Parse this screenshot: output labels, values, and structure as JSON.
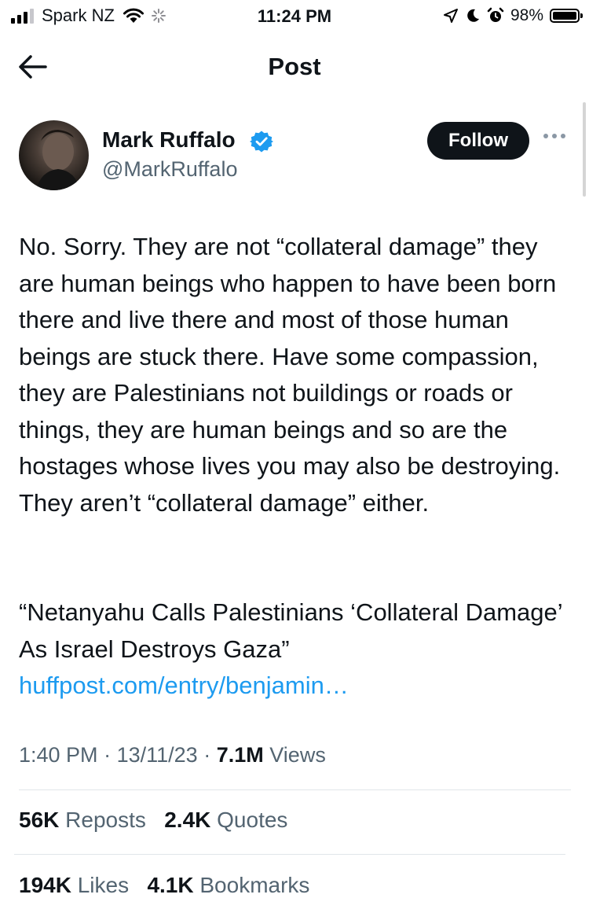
{
  "status_bar": {
    "carrier": "Spark NZ",
    "time": "11:24 PM",
    "battery": "98%"
  },
  "nav": {
    "title": "Post"
  },
  "author": {
    "name": "Mark Ruffalo",
    "handle": "@MarkRuffalo",
    "follow_label": "Follow"
  },
  "tweet": {
    "text": "No. Sorry. They are not “collateral damage” they are human beings who happen to have been born there and live there and most of those human beings are stuck there. Have some compassion, they are Palestinians not buildings or roads or things, they are human beings and so are the hostages whose lives you may also be destroying. They aren’t “collateral damage” either.",
    "quote": "“Netanyahu Calls Palestinians ‘Collateral Damage’ As Israel Destroys Gaza”",
    "link": "huffpost.com/entry/benjamin…"
  },
  "meta": {
    "time": "1:40 PM",
    "date": "13/11/23",
    "views_count": "7.1M",
    "views_label": "Views",
    "separator": "·"
  },
  "stats": {
    "reposts_count": "56K",
    "reposts_label": "Reposts",
    "quotes_count": "2.4K",
    "quotes_label": "Quotes",
    "likes_count": "194K",
    "likes_label": "Likes",
    "bookmarks_count": "4.1K",
    "bookmarks_label": "Bookmarks"
  },
  "colors": {
    "link": "#1d9bf0",
    "verified": "#1d9bf0",
    "secondary_text": "#536471",
    "button_bg": "#0f1419"
  },
  "icons": [
    "signal-icon",
    "wifi-icon",
    "activity-spinner-icon",
    "location-arrow-icon",
    "moon-icon",
    "alarm-icon",
    "battery-icon",
    "back-arrow-icon",
    "verified-badge-icon",
    "more-options-icon"
  ]
}
